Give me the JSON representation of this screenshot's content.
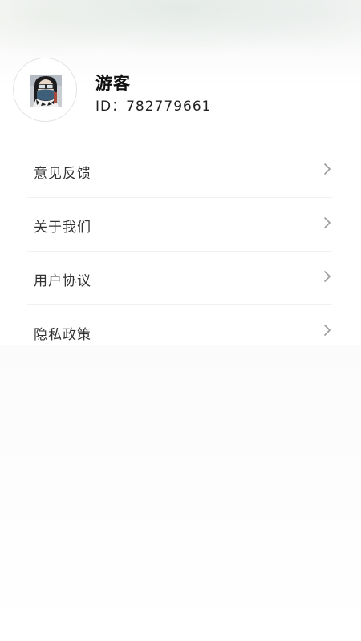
{
  "profile": {
    "nickname": "游客",
    "id_label": "ID：",
    "id_value": "782779661",
    "avatar_icon": "user-avatar-photo"
  },
  "menu": {
    "items": [
      {
        "label": "意见反馈",
        "icon": "chevron-right-icon"
      },
      {
        "label": "关于我们",
        "icon": "chevron-right-icon"
      },
      {
        "label": "用户协议",
        "icon": "chevron-right-icon"
      },
      {
        "label": "隐私政策",
        "icon": "chevron-right-icon"
      }
    ]
  },
  "colors": {
    "background": "#ffffff",
    "text_primary": "#111111",
    "text_menu": "#333333",
    "chevron": "#9a9a9a",
    "divider": "#f2f2f2"
  }
}
